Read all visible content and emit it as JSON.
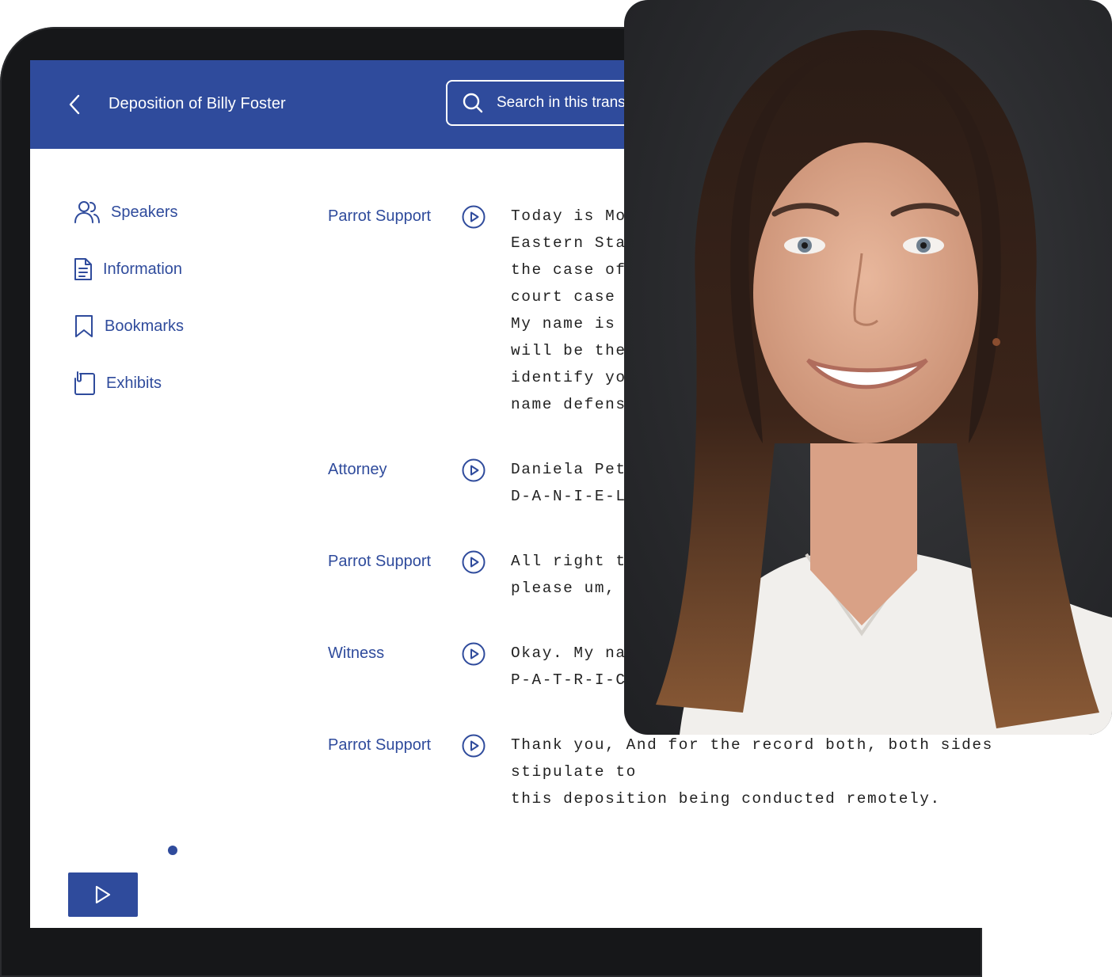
{
  "header": {
    "back_label": "Back",
    "title": "Deposition of Billy Foster",
    "search_placeholder": "Search in this transcript"
  },
  "sidebar": {
    "items": [
      {
        "label": "Speakers",
        "icon": "users-icon"
      },
      {
        "label": "Information",
        "icon": "document-icon"
      },
      {
        "label": "Bookmarks",
        "icon": "bookmark-icon"
      },
      {
        "label": "Exhibits",
        "icon": "clipboard-icon"
      }
    ]
  },
  "transcript": [
    {
      "speaker": "Parrot Support",
      "text": "Today is Mon\nEastern Stan\nthe case of \ncourt case n\nMy name is C\nwill be the \nidentify you\nname defense"
    },
    {
      "speaker": "Attorney",
      "text": "Daniela Pete\nD-A-N-I-E-L-"
    },
    {
      "speaker": "Parrot Support",
      "text": "All right th\nplease um, s"
    },
    {
      "speaker": "Witness",
      "text": "Okay. My nam\nP-A-T-R-I-C-"
    },
    {
      "speaker": "Parrot Support",
      "text": "Thank you, And for the record both, both sides stipulate to\nthis deposition being conducted remotely."
    }
  ],
  "player": {
    "play_label": "Play"
  },
  "colors": {
    "brand": "#2f4b9c",
    "header_text": "#ffffff"
  }
}
